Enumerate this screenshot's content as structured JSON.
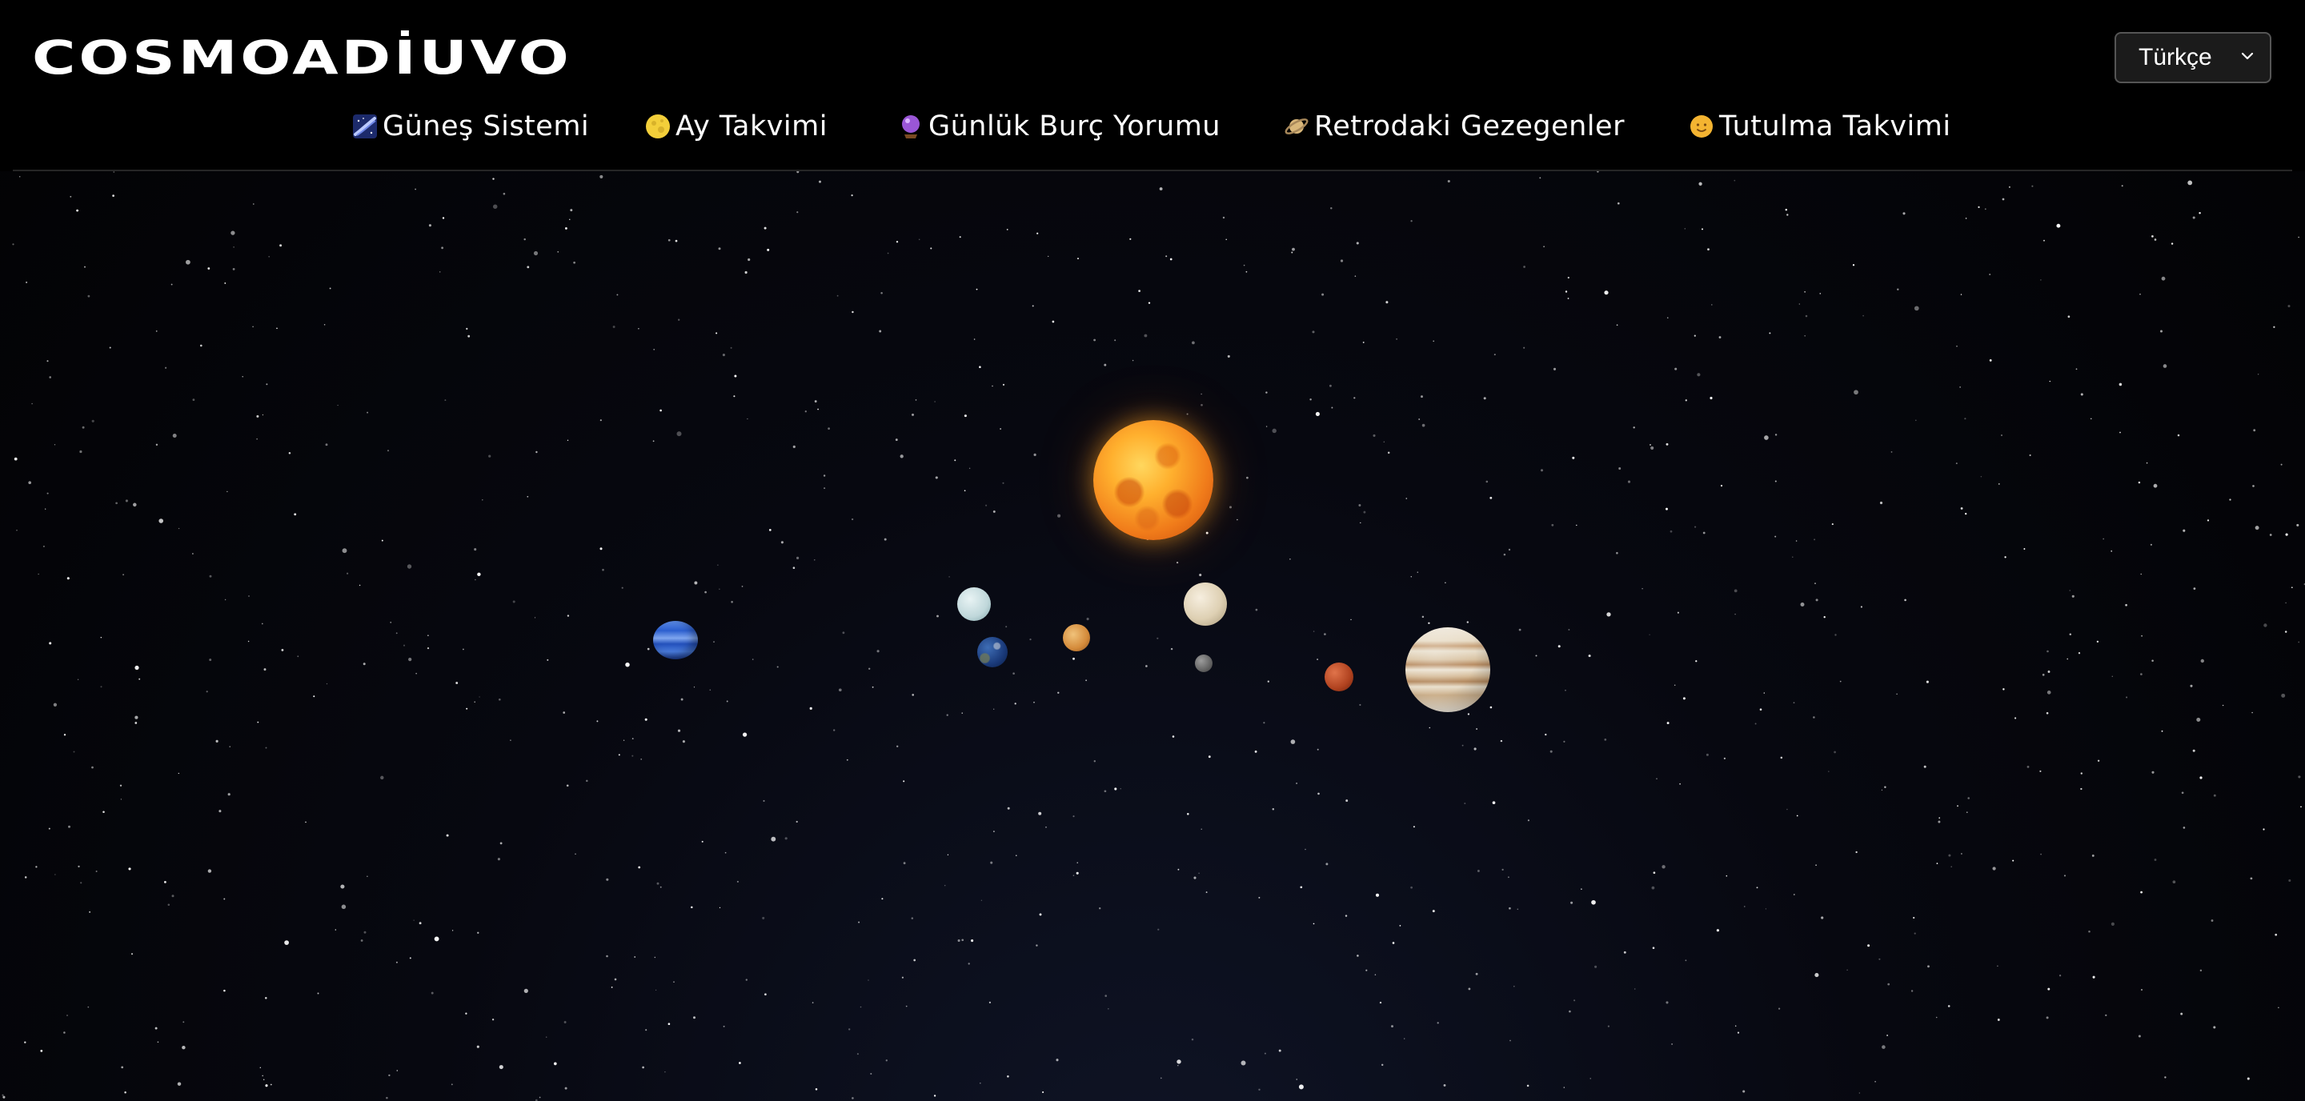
{
  "brand": {
    "logo": "COSMOADİUVO"
  },
  "language_select": {
    "selected": "Türkçe"
  },
  "nav": {
    "items": [
      {
        "label": "Güneş Sistemi",
        "icon": "milky-way-icon"
      },
      {
        "label": "Ay Takvimi",
        "icon": "full-moon-icon"
      },
      {
        "label": "Günlük Burç Yorumu",
        "icon": "crystal-ball-icon"
      },
      {
        "label": "Retrodaki Gezegenler",
        "icon": "ringed-planet-icon"
      },
      {
        "label": "Tutulma Takvimi",
        "icon": "sun-with-face-icon"
      }
    ]
  },
  "solar_system": {
    "bodies": [
      "sun",
      "mercury",
      "venus",
      "earth",
      "mars",
      "jupiter",
      "saturn",
      "uranus",
      "neptune"
    ]
  },
  "colors": {
    "header_bg": "#000000",
    "space_bg": "#06070c",
    "text": "#ffffff"
  }
}
